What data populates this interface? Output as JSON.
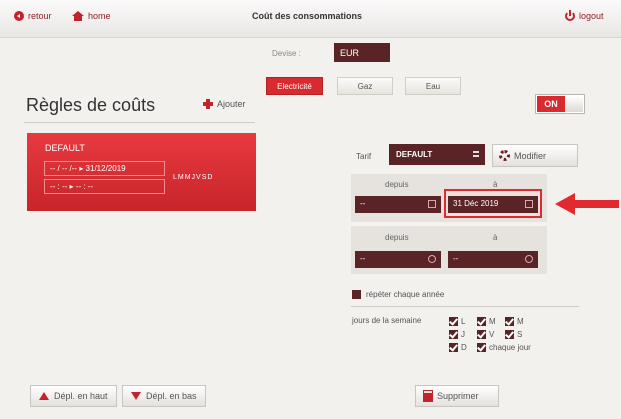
{
  "nav": {
    "back": "retour",
    "home": "home",
    "logout": "logout"
  },
  "page_title": "Coût des consommations",
  "devise": {
    "label": "Devise :",
    "value": "EUR"
  },
  "energy_tabs": [
    {
      "label": "Electricité",
      "active": true
    },
    {
      "label": "Gaz",
      "active": false
    },
    {
      "label": "Eau",
      "active": false
    }
  ],
  "toggle": {
    "label": "ON",
    "state": true
  },
  "rules": {
    "title": "Règles de coûts",
    "add_label": "Ajouter",
    "items": [
      {
        "name": "DEFAULT",
        "date_range": "-- / -- /--   ▸  31/12/2019",
        "time_range": "-- : --    ▸    -- : --",
        "days_code": "LMMJVSD"
      }
    ]
  },
  "detail": {
    "tarif_label": "Tarif",
    "tarif_value": "DEFAULT",
    "modify_label": "Modifier",
    "date_block": {
      "from_label": "depuis",
      "to_label": "à",
      "from_value": "--",
      "to_value": "31 Déc 2019"
    },
    "time_block": {
      "from_label": "depuis",
      "to_label": "à",
      "from_value": "--",
      "to_value": "--"
    },
    "repeat_label": "répéter chaque année",
    "week_label": "jours de la semaine",
    "days": [
      "L",
      "M",
      "M",
      "J",
      "V",
      "S",
      "D"
    ],
    "every_day_label": "chaque jour"
  },
  "bottom": {
    "move_up": "Dépl. en haut",
    "move_down": "Dépl. en bas",
    "delete": "Supprimer"
  },
  "colors": {
    "accent": "#d92a2f",
    "dark_field": "#5a2426",
    "highlight": "#e02a30"
  }
}
